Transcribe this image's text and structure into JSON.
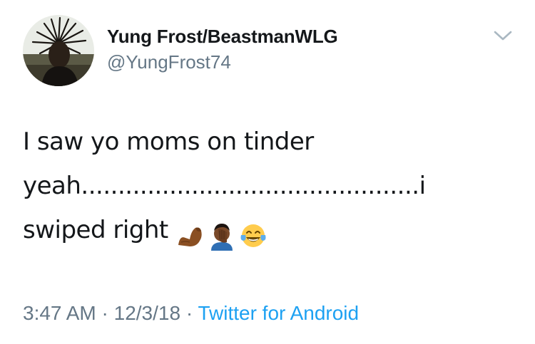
{
  "author": {
    "display_name": "Yung Frost/BeastmanWLG",
    "handle": "@YungFrost74"
  },
  "tweet": {
    "line1": "I saw yo moms on tinder",
    "line2": "yeah..............................................i",
    "line3": "swiped right",
    "emojis": [
      "flexed-biceps-icon",
      "face-palm-icon",
      "tears-of-joy-icon"
    ]
  },
  "meta": {
    "time": "3:47 AM",
    "separator1": " · ",
    "date": "12/3/18",
    "separator2": " · ",
    "source": "Twitter for Android"
  },
  "colors": {
    "text": "#14171a",
    "secondary": "#657786",
    "link": "#1da1f2",
    "chevron": "#aab8c2"
  }
}
